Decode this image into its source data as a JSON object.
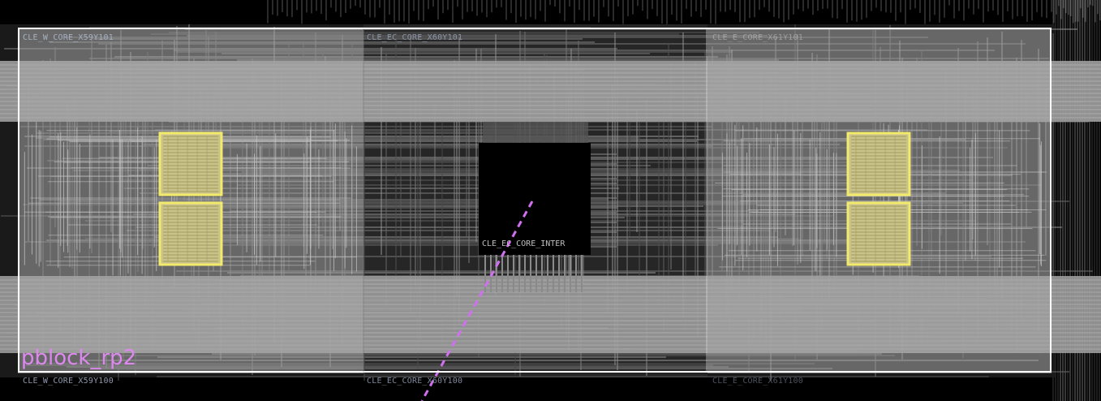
{
  "device_view": {
    "pblock": {
      "name": "pblock_rp2",
      "outline_color": "#ffffff",
      "label_color": "#dd88ee"
    },
    "tiles": [
      {
        "id": "t1",
        "label": "CLE_W_CORE_X59Y101"
      },
      {
        "id": "t2",
        "label": "CLE_EC_CORE_X60Y101"
      },
      {
        "id": "t3",
        "label": "CLE_W_CORE_X59Y100"
      },
      {
        "id": "t4",
        "label": "CLE_EC_CORE_X60Y100"
      },
      {
        "id": "t5",
        "label": "CLE_E_CORE_X61Y101"
      },
      {
        "id": "t6",
        "label": "CLE_E_CORE_X61Y100"
      }
    ],
    "inter_tile": {
      "label": "CLE_EC_CORE_INTER"
    },
    "colors": {
      "background": "#000000",
      "routing": "#9a9a9a",
      "pblock_fill": "#a8a8a8",
      "highlight_cell": "#f2ea6a",
      "net_dashed": "#d070f0",
      "tile_label": "#9aa3b5"
    }
  }
}
